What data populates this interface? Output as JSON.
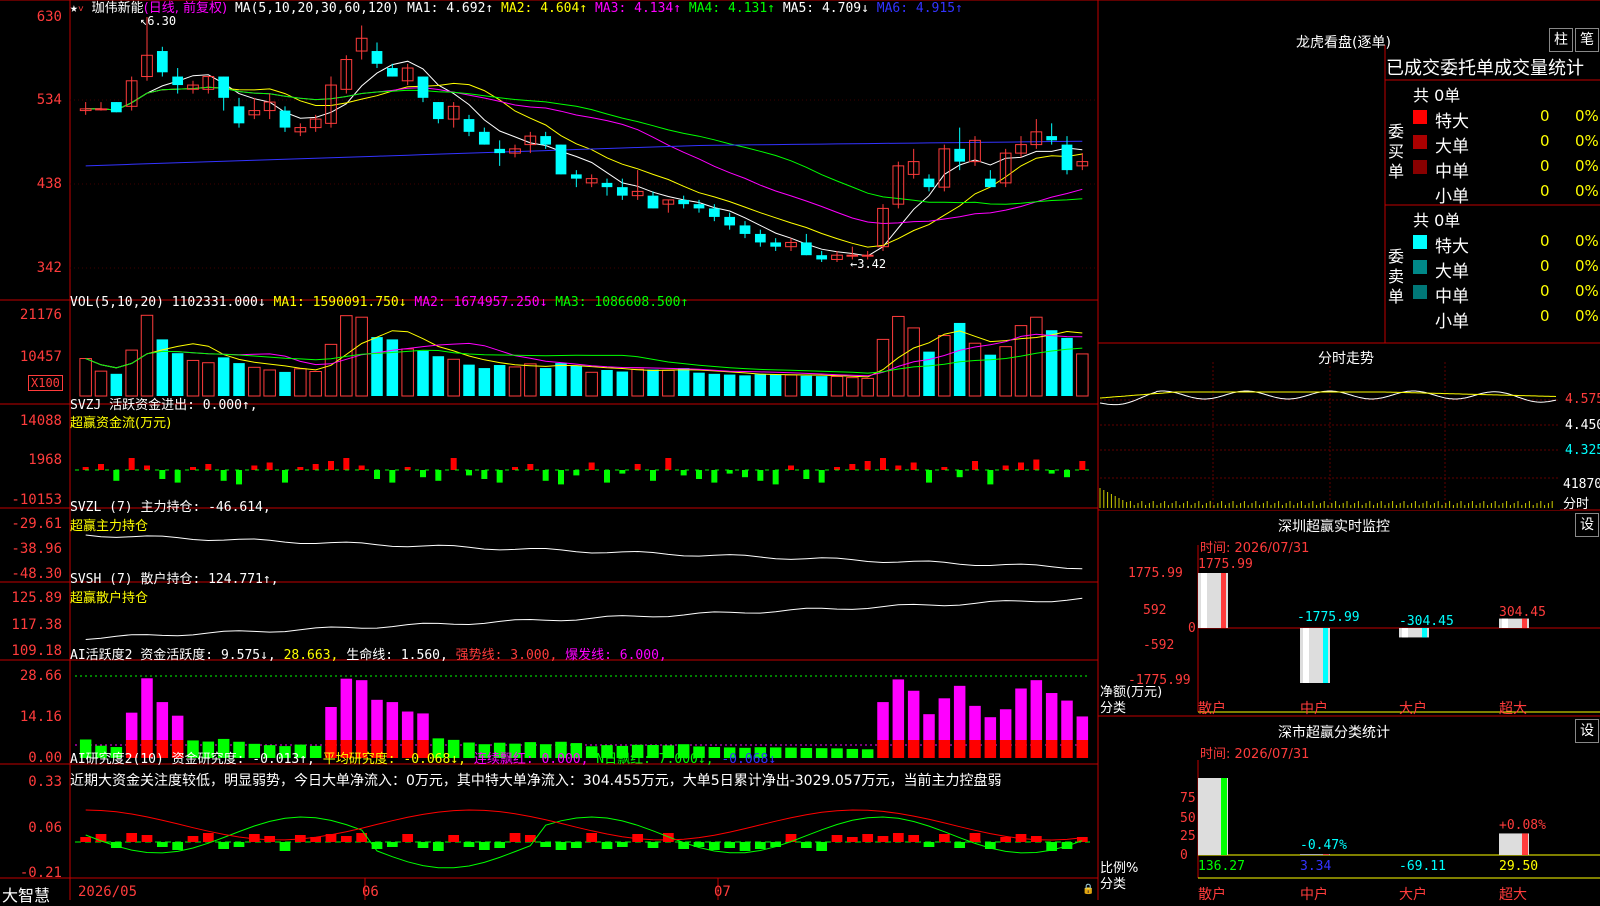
{
  "stock": {
    "name": "珈伟新能",
    "period": "(日线, 前复权)",
    "ma_header": [
      {
        "label": "MA(5,10,20,30,60,120)",
        "color": "#ffffff"
      },
      {
        "label": "MA1: 4.692↑",
        "color": "#ffffff"
      },
      {
        "label": "MA2: 4.604↑",
        "color": "#ffff00"
      },
      {
        "label": "MA3: 4.134↑",
        "color": "#ff00ff"
      },
      {
        "label": "MA4: 4.131↑",
        "color": "#00ff00"
      },
      {
        "label": "MA5: 4.709↓",
        "color": "#ffffff"
      },
      {
        "label": "MA6: 4.915↑",
        "color": "#3333ff"
      }
    ],
    "high_mark": "6.30",
    "low_mark": "←3.42",
    "price_axis": [
      "630",
      "534",
      "438",
      "342"
    ],
    "favorite_icon": "star-icon",
    "dropdown_icon": "chevron-down-icon"
  },
  "volume": {
    "header": [
      {
        "label": "VOL(5,10,20)",
        "color": "#ffffff"
      },
      {
        "label": "1102331.000↓",
        "color": "#ffffff"
      },
      {
        "label": "MA1: 1590091.750↓",
        "color": "#ffff00"
      },
      {
        "label": "MA2: 1674957.250↓",
        "color": "#ff00ff"
      },
      {
        "label": "MA3: 1086608.500↑",
        "color": "#00ff00"
      }
    ],
    "axis": [
      "21176",
      "10457"
    ],
    "unit": "X100"
  },
  "svzj": {
    "header": [
      {
        "label": "SVZJ  活跃资金进出: 0.000↑,",
        "color": "#ffffff"
      }
    ],
    "subtitle": "超赢资金流(万元)",
    "axis": [
      "14088",
      "1968",
      "-10153"
    ]
  },
  "svzl": {
    "header": [
      {
        "label": "SVZL (7) 主力持仓: -46.614,",
        "color": "#ffffff"
      }
    ],
    "subtitle": "超赢主力持仓",
    "axis": [
      "-29.61",
      "-38.96",
      "-48.30"
    ]
  },
  "svsh": {
    "header": [
      {
        "label": "SVSH (7) 散户持仓: 124.771↑,",
        "color": "#ffffff"
      }
    ],
    "subtitle": "超赢散户持仓",
    "axis": [
      "125.89",
      "117.38",
      "109.18"
    ]
  },
  "ai_active": {
    "header": [
      {
        "label": "AI活跃度2 资金活跃度: 9.575↓,",
        "color": "#ffffff"
      },
      {
        "label": "28.663,",
        "color": "#ffff00"
      },
      {
        "label": "生命线: 1.560,",
        "color": "#ffffff"
      },
      {
        "label": "强势线: 3.000,",
        "color": "#ff3c3c"
      },
      {
        "label": "爆发线: 6.000,",
        "color": "#ff00ff"
      }
    ],
    "axis": [
      "28.66",
      "14.16",
      "0.00"
    ]
  },
  "ai_research": {
    "header": [
      {
        "label": "AI研究度2(10) 资金研究度: -0.013↑,",
        "color": "#ffffff"
      },
      {
        "label": "平均研究度: -0.068↓,",
        "color": "#ffff00"
      },
      {
        "label": "连续飘红: 0.000,",
        "color": "#ff00ff"
      },
      {
        "label": "N日飘红: 7.000↓,",
        "color": "#00ff00"
      },
      {
        "label": "-0.068↓",
        "color": "#3333ff"
      }
    ],
    "comment": "近期大资金关注度较低，明显弱势，今日大单净流入：0万元，其中特大单净流入：304.455万元，大单5日累计净出-3029.057万元，当前主力控盘弱",
    "axis": [
      "0.33",
      "0.06",
      "-0.21"
    ]
  },
  "bottom_axis": {
    "brand": "大智慧",
    "labels": [
      "2026/05",
      "06",
      "07"
    ],
    "lock_icon": "lock-icon"
  },
  "dragon_tiger": {
    "title": "龙虎看盘(逐单)",
    "buttons": [
      "柱",
      "笔"
    ],
    "tabs": "已成交委托单成交量统计",
    "buy": {
      "label": "委买单",
      "total": "共 0单",
      "rows": [
        {
          "name": "特大",
          "count": "0",
          "pct": "0%",
          "color": "#ff0000"
        },
        {
          "name": "大单",
          "count": "0",
          "pct": "0%",
          "color": "#aa0000"
        },
        {
          "name": "中单",
          "count": "0",
          "pct": "0%",
          "color": "#880000"
        },
        {
          "name": "小单",
          "count": "0",
          "pct": "0%",
          "color": "#000000"
        }
      ]
    },
    "sell": {
      "label": "委卖单",
      "total": "共 0单",
      "rows": [
        {
          "name": "特大",
          "count": "0",
          "pct": "0%",
          "color": "#00ffff"
        },
        {
          "name": "大单",
          "count": "0",
          "pct": "0%",
          "color": "#008888"
        },
        {
          "name": "中单",
          "count": "0",
          "pct": "0%",
          "color": "#007777"
        },
        {
          "name": "小单",
          "count": "0",
          "pct": "0%",
          "color": "#000000"
        }
      ]
    }
  },
  "intraday": {
    "title": "分时走势",
    "axis": [
      "4.575",
      "4.450",
      "4.325"
    ],
    "vol_label": "41870",
    "time_label": "分时"
  },
  "sz_monitor": {
    "title": "深圳超赢实时监控",
    "settings_btn": "设",
    "time": "时间: 2026/07/31",
    "axis": [
      "1775.99",
      "592",
      "0",
      "-592",
      "-1775.99"
    ],
    "axis_title": "净额(万元)",
    "cat_title": "分类",
    "categories": [
      "散户",
      "中户",
      "大户",
      "超大"
    ],
    "values": [
      1775.99,
      -1775.99,
      -304.45,
      304.45
    ],
    "value_labels": [
      "1775.99",
      "-1775.99",
      "-304.45",
      "304.45"
    ]
  },
  "sz_class": {
    "title": "深市超赢分类统计",
    "settings_btn": "设",
    "time": "时间: 2026/07/31",
    "axis": [
      "75",
      "50",
      "25",
      "0"
    ],
    "axis_title": "比例%",
    "cat_title": "分类",
    "categories": [
      "散户",
      "中户",
      "大户",
      "超大"
    ],
    "top_labels": [
      "",
      "-0.47%",
      "",
      "+0.08%"
    ],
    "bottom_values": [
      "136.27",
      "3.34",
      "-69.11",
      "29.50"
    ],
    "bottom_colors": [
      "#00ff00",
      "#3333ff",
      "#00ffff",
      "#ffff00"
    ],
    "percent_values": [
      100,
      1,
      0,
      28
    ]
  },
  "chart_data": {
    "type": "candlestick",
    "title": "珈伟新能 (日线, 前复权)",
    "x_labels": [
      "2026/05",
      "06",
      "07"
    ],
    "ohlc": [
      [
        5.2,
        5.3,
        5.15,
        5.22
      ],
      [
        5.22,
        5.3,
        5.2,
        5.22
      ],
      [
        5.3,
        5.3,
        5.18,
        5.18
      ],
      [
        5.25,
        5.6,
        5.2,
        5.55
      ],
      [
        5.6,
        6.3,
        5.55,
        5.85
      ],
      [
        5.9,
        5.95,
        5.6,
        5.65
      ],
      [
        5.6,
        5.7,
        5.4,
        5.5
      ],
      [
        5.45,
        5.55,
        5.4,
        5.5
      ],
      [
        5.45,
        5.6,
        5.4,
        5.6
      ],
      [
        5.6,
        5.6,
        5.2,
        5.35
      ],
      [
        5.25,
        5.35,
        5.0,
        5.05
      ],
      [
        5.15,
        5.35,
        5.1,
        5.2
      ],
      [
        5.2,
        5.4,
        5.1,
        5.3
      ],
      [
        5.2,
        5.25,
        4.95,
        5.0
      ],
      [
        4.95,
        5.05,
        4.9,
        5.0
      ],
      [
        5.0,
        5.15,
        4.95,
        5.1
      ],
      [
        5.05,
        5.6,
        5.0,
        5.5
      ],
      [
        5.45,
        5.85,
        5.4,
        5.8
      ],
      [
        5.9,
        6.2,
        5.8,
        6.05
      ],
      [
        5.9,
        6.0,
        5.7,
        5.75
      ],
      [
        5.7,
        5.75,
        5.6,
        5.6
      ],
      [
        5.55,
        5.75,
        5.5,
        5.7
      ],
      [
        5.6,
        5.6,
        5.3,
        5.35
      ],
      [
        5.3,
        5.3,
        5.05,
        5.1
      ],
      [
        5.1,
        5.3,
        5.0,
        5.25
      ],
      [
        5.1,
        5.15,
        4.9,
        4.95
      ],
      [
        4.95,
        5.0,
        4.8,
        4.8
      ],
      [
        4.75,
        4.85,
        4.55,
        4.7
      ],
      [
        4.7,
        4.8,
        4.65,
        4.75
      ],
      [
        4.8,
        4.95,
        4.7,
        4.9
      ],
      [
        4.9,
        4.95,
        4.75,
        4.8
      ],
      [
        4.8,
        4.8,
        4.45,
        4.45
      ],
      [
        4.45,
        4.5,
        4.3,
        4.4
      ],
      [
        4.35,
        4.45,
        4.3,
        4.4
      ],
      [
        4.35,
        4.4,
        4.2,
        4.3
      ],
      [
        4.3,
        4.4,
        4.15,
        4.2
      ],
      [
        4.2,
        4.5,
        4.15,
        4.25
      ],
      [
        4.2,
        4.25,
        4.05,
        4.05
      ],
      [
        4.1,
        4.15,
        4.0,
        4.15
      ],
      [
        4.15,
        4.2,
        4.05,
        4.1
      ],
      [
        4.1,
        4.15,
        4.0,
        4.05
      ],
      [
        4.05,
        4.1,
        3.9,
        3.95
      ],
      [
        3.95,
        4.0,
        3.8,
        3.85
      ],
      [
        3.85,
        3.9,
        3.7,
        3.75
      ],
      [
        3.75,
        3.8,
        3.6,
        3.65
      ],
      [
        3.65,
        3.7,
        3.55,
        3.6
      ],
      [
        3.6,
        3.7,
        3.55,
        3.65
      ],
      [
        3.65,
        3.75,
        3.5,
        3.5
      ],
      [
        3.5,
        3.55,
        3.42,
        3.45
      ],
      [
        3.45,
        3.55,
        3.42,
        3.5
      ],
      [
        3.5,
        3.6,
        3.45,
        3.5
      ],
      [
        3.5,
        3.55,
        3.45,
        3.5
      ],
      [
        3.6,
        4.1,
        3.55,
        4.05
      ],
      [
        4.1,
        4.6,
        4.05,
        4.55
      ],
      [
        4.45,
        4.75,
        4.4,
        4.6
      ],
      [
        4.4,
        4.45,
        4.25,
        4.3
      ],
      [
        4.3,
        4.8,
        4.25,
        4.75
      ],
      [
        4.75,
        5.0,
        4.5,
        4.6
      ],
      [
        4.6,
        4.9,
        4.55,
        4.85
      ],
      [
        4.4,
        4.5,
        4.3,
        4.3
      ],
      [
        4.35,
        4.75,
        4.3,
        4.7
      ],
      [
        4.7,
        4.9,
        4.65,
        4.8
      ],
      [
        4.8,
        5.1,
        4.75,
        4.95
      ],
      [
        4.9,
        5.05,
        4.8,
        4.85
      ],
      [
        4.8,
        4.9,
        4.45,
        4.5
      ],
      [
        4.55,
        4.7,
        4.5,
        4.6
      ]
    ],
    "volume": [
      9800,
      6500,
      5800,
      12000,
      21100,
      14800,
      11200,
      9300,
      8700,
      10100,
      8600,
      7500,
      6800,
      6300,
      7100,
      6400,
      13500,
      21000,
      20600,
      15400,
      14800,
      12300,
      11800,
      10400,
      9600,
      8200,
      7300,
      8100,
      7600,
      8400,
      7300,
      8600,
      7900,
      6200,
      6800,
      6400,
      7000,
      6900,
      6700,
      7300,
      6100,
      5800,
      5600,
      5400,
      5700,
      5600,
      5500,
      5300,
      5200,
      5100,
      4800,
      4600,
      14800,
      20800,
      17800,
      11600,
      15800,
      19100,
      13800,
      10800,
      12900,
      18400,
      20600,
      17200,
      15200,
      11000
    ]
  }
}
